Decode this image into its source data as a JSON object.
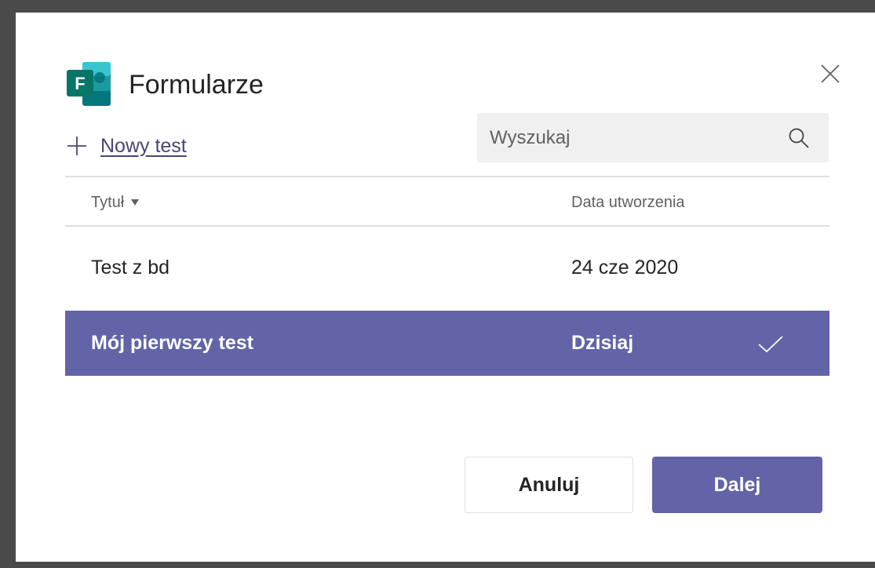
{
  "dialog": {
    "app_title": "Formularze",
    "logo_letter": "F",
    "new_test_label": "Nowy test",
    "search": {
      "placeholder": "Wyszukaj",
      "value": ""
    },
    "table": {
      "headers": {
        "title": "Tytuł",
        "date": "Data utworzenia"
      },
      "rows": [
        {
          "title": "Test z bd",
          "date": "24 cze 2020",
          "selected": false
        },
        {
          "title": "Mój pierwszy test",
          "date": "Dzisiaj",
          "selected": true
        }
      ]
    },
    "buttons": {
      "cancel": "Anuluj",
      "next": "Dalej"
    }
  },
  "icons": {
    "logo": "microsoft-forms-icon",
    "close": "close-icon",
    "add": "plus-icon",
    "search": "search-icon",
    "sort": "sort-down-icon",
    "selected": "checkmark-icon"
  },
  "colors": {
    "accent": "#6264a7",
    "link": "#464775",
    "forms_dark": "#03787c",
    "forms_mid": "#008272",
    "forms_light": "#37c6d0"
  }
}
